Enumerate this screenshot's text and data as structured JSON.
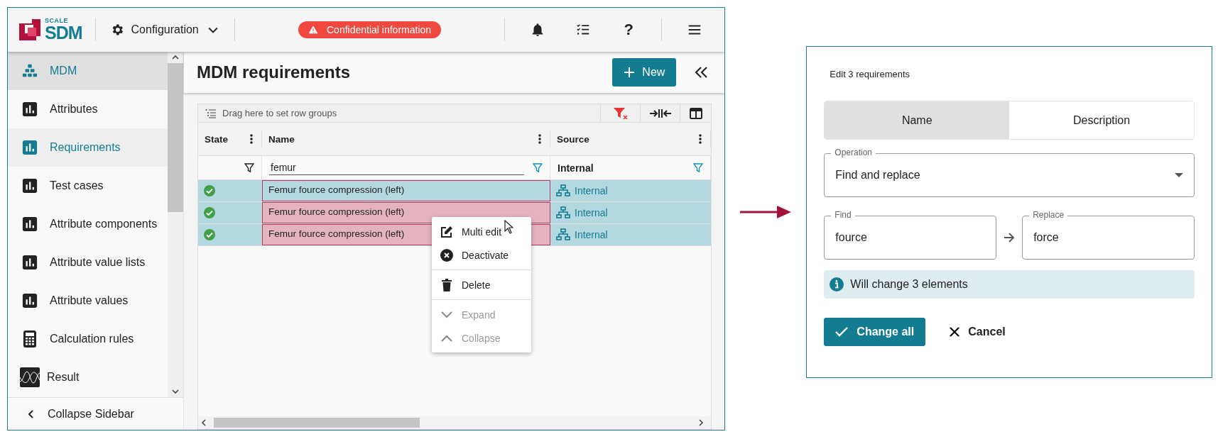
{
  "header": {
    "logo_top": "SCALE",
    "logo_main": "SDM",
    "module": "Configuration",
    "alert": "Confidential information",
    "help": "?"
  },
  "sidebar": {
    "items": [
      {
        "label": "MDM",
        "kind": "section",
        "selected": false
      },
      {
        "label": "Attributes",
        "kind": "table",
        "selected": false
      },
      {
        "label": "Requirements",
        "kind": "table",
        "selected": true
      },
      {
        "label": "Test cases",
        "kind": "table",
        "selected": false
      },
      {
        "label": "Attribute components",
        "kind": "table",
        "selected": false
      },
      {
        "label": "Attribute value lists",
        "kind": "table",
        "selected": false
      },
      {
        "label": "Attribute values",
        "kind": "table",
        "selected": false
      },
      {
        "label": "Calculation rules",
        "kind": "calculator",
        "selected": false
      },
      {
        "label": "Result",
        "kind": "result",
        "selected": false
      }
    ],
    "collapse": "Collapse Sidebar"
  },
  "page": {
    "title": "MDM requirements",
    "new_button": "New"
  },
  "grid": {
    "group_hint": "Drag here to set row groups",
    "columns": [
      {
        "title": "State"
      },
      {
        "title": "Name"
      },
      {
        "title": "Source"
      }
    ],
    "filters": {
      "name": "femur",
      "source": "Internal"
    },
    "rows": [
      {
        "active": true,
        "selected": true,
        "name": "Femur fource compression (left)",
        "name_highlighted": false,
        "source": "Internal"
      },
      {
        "active": true,
        "selected": true,
        "name": "Femur fource compression (left)",
        "name_highlighted": true,
        "source": "Internal"
      },
      {
        "active": true,
        "selected": true,
        "name": "Femur fource compression (left)",
        "name_highlighted": true,
        "source": "Internal"
      }
    ]
  },
  "context_menu": {
    "groups": [
      [
        {
          "label": "Multi edit",
          "kind": "edit",
          "disabled": false
        },
        {
          "label": "Deactivate",
          "kind": "deactivate",
          "disabled": false
        }
      ],
      [
        {
          "label": "Delete",
          "kind": "delete",
          "disabled": false
        }
      ],
      [
        {
          "label": "Expand",
          "kind": "expand",
          "disabled": true
        },
        {
          "label": "Collapse",
          "kind": "collapse",
          "disabled": true
        }
      ]
    ]
  },
  "dialog": {
    "title": "Edit 3 requirements",
    "tabs": [
      {
        "label": "Name",
        "selected": true
      },
      {
        "label": "Description",
        "selected": false
      }
    ],
    "operation": {
      "label": "Operation",
      "value": "Find and replace"
    },
    "find": {
      "label": "Find",
      "value": "fource"
    },
    "replace": {
      "label": "Replace",
      "value": "force"
    },
    "info": "Will change 3 elements",
    "confirm": "Change all",
    "cancel": "Cancel"
  }
}
